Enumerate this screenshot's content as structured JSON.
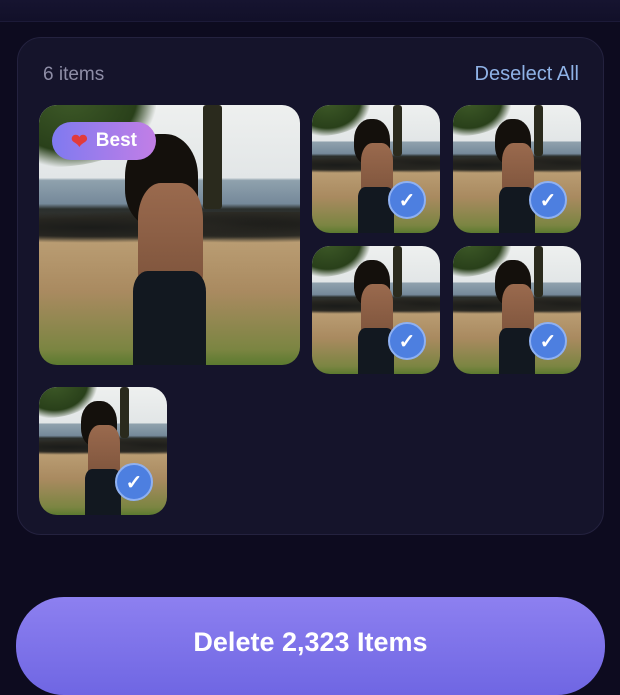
{
  "header": {
    "item_count": "6 items",
    "deselect_label": "Deselect All"
  },
  "best_badge": {
    "label": "Best"
  },
  "photos": [
    {
      "id": "best",
      "selected": false,
      "best": true
    },
    {
      "id": "p2",
      "selected": true
    },
    {
      "id": "p3",
      "selected": true
    },
    {
      "id": "p4",
      "selected": true
    },
    {
      "id": "p5",
      "selected": true
    },
    {
      "id": "p6",
      "selected": true
    }
  ],
  "check_glyph": "✓",
  "delete_button": {
    "label": "Delete 2,323 Items"
  },
  "colors": {
    "accent": "#7f78ea",
    "check": "#4d7fe0",
    "link": "#8fb2e6"
  }
}
